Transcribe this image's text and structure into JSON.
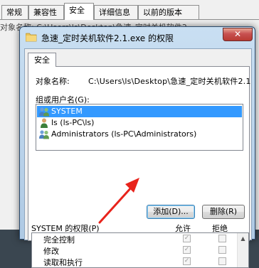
{
  "background_window": {
    "tabs": [
      "常规",
      "兼容性",
      "安全",
      "详细信息",
      "以前的版本"
    ],
    "active_tab": "安全",
    "partial_text": "对象名称:  C:\\Users\\ls\\Desktop\\急速_定时关机软件2"
  },
  "dialog": {
    "title": "急速_定时关机软件2.1.exe 的权限",
    "close_glyph": "✕",
    "tab": "安全",
    "object_name_label": "对象名称:",
    "object_name_value": "C:\\Users\\ls\\Desktop\\急速_定时关机软件2.1",
    "group_label": "组或用户名(G):",
    "users": [
      {
        "name": "SYSTEM",
        "icon": "users-group-icon",
        "selected": true
      },
      {
        "name": "ls (ls-PC\\ls)",
        "icon": "user-icon",
        "selected": false
      },
      {
        "name": "Administrators (ls-PC\\Administrators)",
        "icon": "users-group-icon",
        "selected": false
      }
    ],
    "add_button": "添加(D)...",
    "remove_button": "删除(R)",
    "permissions_label": "SYSTEM 的权限(P)",
    "allow_header": "允许",
    "deny_header": "拒绝",
    "permissions": [
      {
        "name": "完全控制",
        "allow": true,
        "deny": false
      },
      {
        "name": "修改",
        "allow": true,
        "deny": false
      },
      {
        "name": "读取和执行",
        "allow": true,
        "deny": false
      }
    ],
    "check_glyph": "✓",
    "scroll_up_glyph": "▲"
  },
  "colors": {
    "selection": "#3399ff",
    "annotation_arrow": "#e8231b",
    "close_button": "#c75050"
  }
}
